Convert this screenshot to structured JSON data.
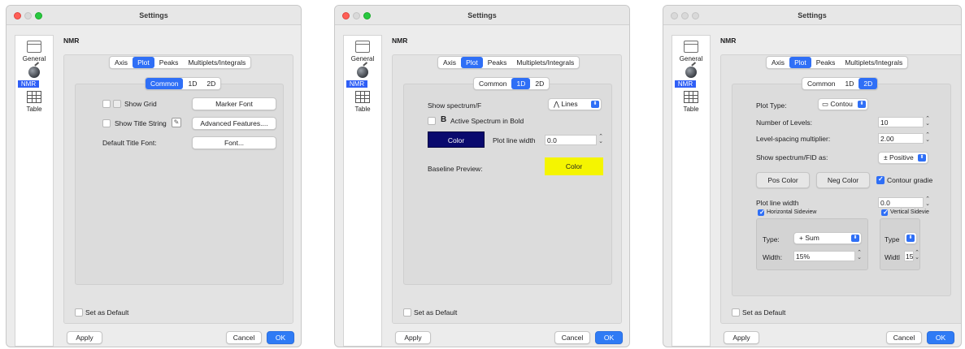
{
  "common": {
    "title": "Settings",
    "sidebar": [
      "General",
      "NMR",
      "Table"
    ],
    "heading": "NMR",
    "main_tabs": [
      "Axis",
      "Plot",
      "Peaks",
      "Multiplets/Integrals"
    ],
    "sub_tabs": [
      "Common",
      "1D",
      "2D"
    ],
    "set_default": "Set as Default",
    "apply": "Apply",
    "cancel": "Cancel",
    "ok": "OK"
  },
  "win1": {
    "show_grid": "Show Grid",
    "marker_font": "Marker Font",
    "show_title": "Show Title String",
    "advanced": "Advanced Features....",
    "default_title_font": "Default Title Font:",
    "font_btn": "Font..."
  },
  "win2": {
    "show_spectrum": "Show spectrum/F",
    "lines_popup": "Lines",
    "active_bold_glyph": "B",
    "active_bold": "Active Spectrum in Bold",
    "color_btn": "Color",
    "plot_line_width": "Plot line width",
    "plot_line_width_value": "0.0",
    "baseline_preview": "Baseline Preview:",
    "baseline_color": "Color",
    "colors": {
      "dark_swatch": "#0a0a6e",
      "baseline_swatch": "#f5f500"
    }
  },
  "win3": {
    "plot_type": "Plot Type:",
    "plot_type_value": "Contou",
    "num_levels": "Number of Levels:",
    "num_levels_value": "10",
    "level_spacing": "Level-spacing multiplier:",
    "level_spacing_value": "2.00",
    "show_as": "Show spectrum/FID as:",
    "show_as_value": "± Positive",
    "pos_color": "Pos Color",
    "neg_color": "Neg Color",
    "contour_gradient": "Contour gradie",
    "plot_line_width": "Plot line width",
    "plot_line_width_value": "0.0",
    "h_sideview": "Horizontal Sideview",
    "v_sideview": "Vertical Sidevie",
    "type_label": "Type:",
    "type_value": "+ Sum",
    "type_label_v": "Type",
    "width_label": "Width:",
    "width_value": "15%",
    "width_label_v": "Widtl",
    "width_value_v": "15"
  }
}
